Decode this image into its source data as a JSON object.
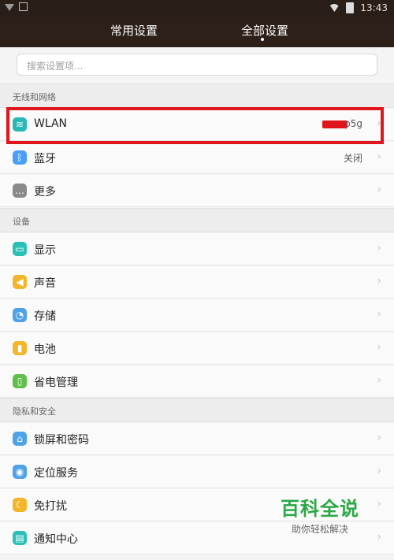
{
  "status_bar": {
    "time": "13:43"
  },
  "tabs": [
    {
      "label": "常用设置"
    },
    {
      "label": "全部设置"
    }
  ],
  "search": {
    "placeholder": "搜索设置项..."
  },
  "sections": {
    "wireless": {
      "title": "无线和网络"
    },
    "device": {
      "title": "设备"
    },
    "privacy": {
      "title": "隐私和安全"
    }
  },
  "rows": {
    "wlan": {
      "label": "WLAN",
      "value": "p5g",
      "icon": "wifi-icon",
      "color": "#27b9b5"
    },
    "bluetooth": {
      "label": "蓝牙",
      "value": "关闭",
      "icon": "bluetooth-icon",
      "color": "#4a9ff5"
    },
    "more": {
      "label": "更多",
      "icon": "more-icon",
      "color": "#8a8a8a"
    },
    "display": {
      "label": "显示",
      "icon": "display-icon",
      "color": "#2bbfb6"
    },
    "sound": {
      "label": "声音",
      "icon": "sound-icon",
      "color": "#f3b52a"
    },
    "storage": {
      "label": "存储",
      "icon": "storage-icon",
      "color": "#4fa2e8"
    },
    "battery": {
      "label": "电池",
      "icon": "battery-icon",
      "color": "#f3b52a"
    },
    "power": {
      "label": "省电管理",
      "icon": "power-saving-icon",
      "color": "#5fbf4b"
    },
    "lock": {
      "label": "锁屏和密码",
      "icon": "lock-icon",
      "color": "#4fa2e8"
    },
    "location": {
      "label": "定位服务",
      "icon": "location-icon",
      "color": "#4fa2e8"
    },
    "dnd": {
      "label": "免打扰",
      "icon": "moon-icon",
      "color": "#f3b52a"
    },
    "notify": {
      "label": "通知中心",
      "icon": "notification-icon",
      "color": "#2bbfb6"
    }
  },
  "watermark": {
    "title": "百科全说",
    "subtitle": "助你轻松解决"
  }
}
